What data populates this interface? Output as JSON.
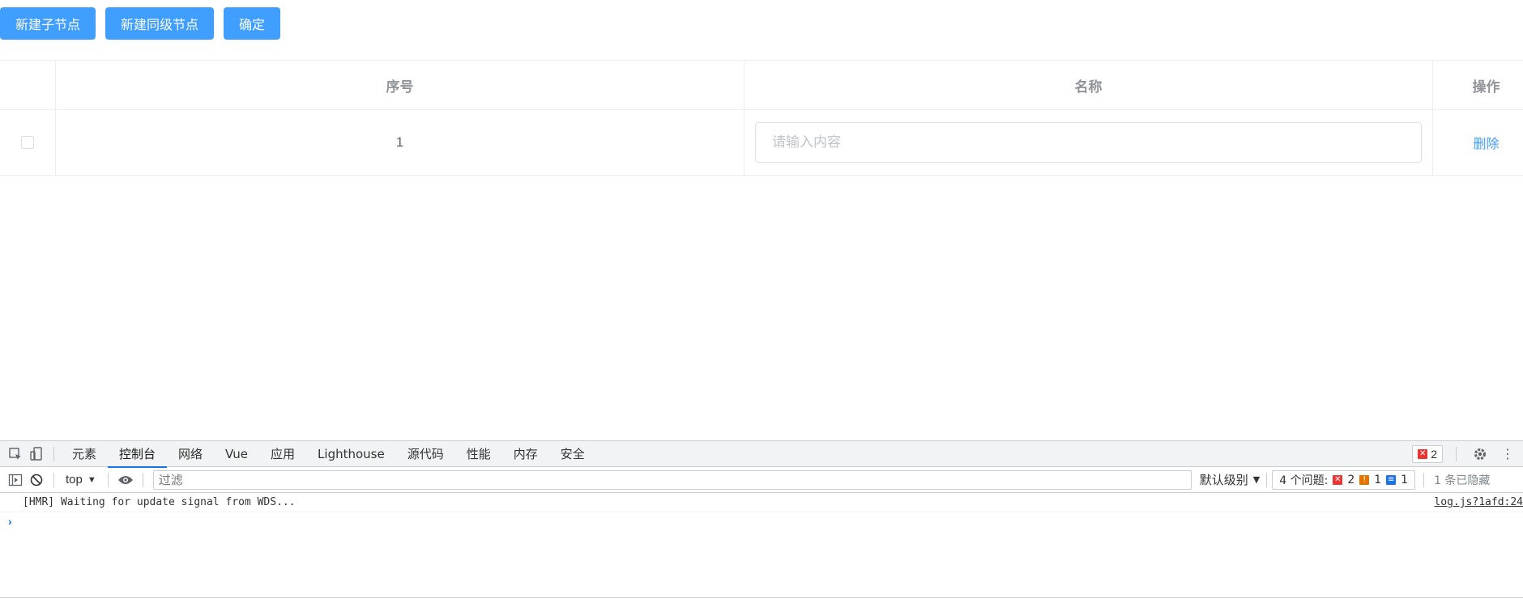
{
  "toolbar": {
    "add_child_label": "新建子节点",
    "add_sibling_label": "新建同级节点",
    "confirm_label": "确定"
  },
  "table": {
    "columns": [
      "序号",
      "名称",
      "操作"
    ],
    "rows": [
      {
        "index": "1",
        "name_placeholder": "请输入内容",
        "name_value": "",
        "action": "删除"
      }
    ]
  },
  "devtools": {
    "tabs": [
      "元素",
      "控制台",
      "网络",
      "Vue",
      "应用",
      "Lighthouse",
      "源代码",
      "性能",
      "内存",
      "安全"
    ],
    "active_tab": "控制台",
    "error_count": "2",
    "context": "top",
    "filter_placeholder": "过滤",
    "log_level": "默认级别",
    "issues_label": "4 个问题:",
    "issues_errors": "2",
    "issues_warnings": "1",
    "issues_info": "1",
    "hidden_label": "1 条已隐藏",
    "log_message": "[HMR] Waiting for update signal from WDS...",
    "log_source": "log.js?1afd:24",
    "colors": {
      "accent": "#1a73e8",
      "primary_button": "#409eff",
      "error": "#e33333"
    }
  }
}
